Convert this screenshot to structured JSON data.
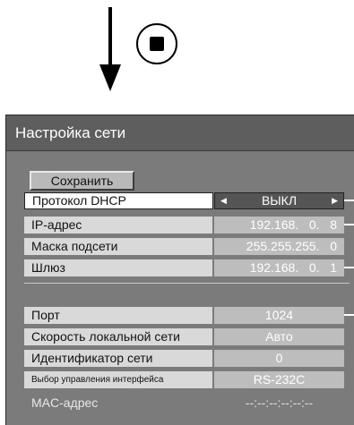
{
  "instruction": {
    "arrow_icon": "down-arrow-icon",
    "stop_icon": "stop-button-icon"
  },
  "menu": {
    "title": "Настройка сети",
    "save_label": "Сохранить",
    "rows": [
      {
        "label": "Протокол DHCP",
        "value": "ВЫКЛ"
      },
      {
        "label": "IP-адрес",
        "value": "192.168.   0.   8"
      },
      {
        "label": "Маска подсети",
        "value": "255.255.255.   0"
      },
      {
        "label": "Шлюз",
        "value": "192.168.   0.   1"
      },
      {
        "label": "Порт",
        "value": "1024"
      },
      {
        "label": "Скорость локальной сети",
        "value": "Авто"
      },
      {
        "label": "Идентификатор сети",
        "value": "0"
      },
      {
        "label": "Выбор управления интерфейса",
        "value": "RS-232C"
      },
      {
        "label": "MAC-адрес",
        "value": "--:--:--:--:--:--"
      }
    ]
  },
  "colors": {
    "menu_bg": "#7b7b7b",
    "title_bar": "#5e5e5e",
    "label_bg": "#d9d9d9",
    "value_bg": "#bdbdbd",
    "selected_value_bg": "#555555"
  }
}
